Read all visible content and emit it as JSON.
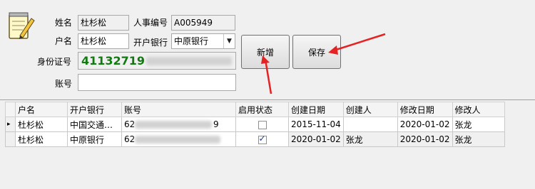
{
  "form": {
    "name_label": "姓名",
    "name_value": "杜杉松",
    "emp_no_label": "人事编号",
    "emp_no_value": "A005949",
    "account_name_label": "户名",
    "account_name_value": "杜杉松",
    "bank_label": "开户银行",
    "bank_value": "中原银行",
    "id_label": "身份证号",
    "id_value": "41132719",
    "account_label": "账号",
    "account_value": ""
  },
  "buttons": {
    "add_label": "新增",
    "save_label": "保存"
  },
  "grid": {
    "columns": [
      "户名",
      "开户银行",
      "账号",
      "启用状态",
      "创建日期",
      "创建人",
      "修改日期",
      "修改人"
    ],
    "rows": [
      {
        "account_name": "杜杉松",
        "bank": "中国交通…",
        "account_prefix": "62",
        "account_suffix": "9",
        "enabled": false,
        "created_date": "2015-11-04",
        "created_by": "",
        "modified_date": "2020-01-02",
        "modified_by": "张龙"
      },
      {
        "account_name": "杜杉松",
        "bank": "中原银行",
        "account_prefix": "62",
        "account_suffix": "",
        "enabled": true,
        "created_date": "2020-01-02",
        "created_by": "张龙",
        "modified_date": "2020-01-02",
        "modified_by": "张龙"
      }
    ],
    "row_indicator": "▸"
  },
  "icons": {
    "form_icon": "notepad-pencil-icon",
    "dropdown": "chevron-down-icon"
  },
  "colors": {
    "id_text": "#117a11",
    "annotation_arrow": "#e52222"
  }
}
